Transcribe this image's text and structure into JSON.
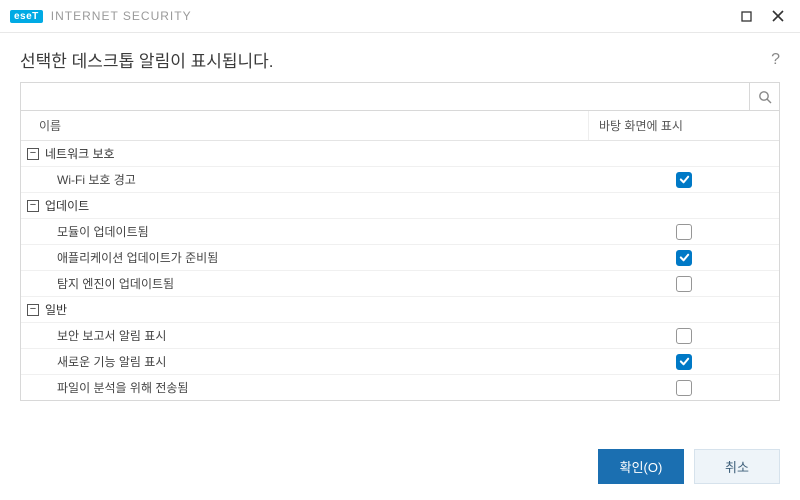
{
  "titlebar": {
    "logo_text": "eseT",
    "product_name": "INTERNET SECURITY"
  },
  "header": {
    "title": "선택한 데스크톱 알림이 표시됩니다.",
    "help": "?"
  },
  "grid": {
    "col_name": "이름",
    "col_show": "바탕 화면에 표시"
  },
  "groups": [
    {
      "label": "네트워크 보호",
      "items": [
        {
          "label": "Wi-Fi 보호 경고",
          "checked": true
        }
      ]
    },
    {
      "label": "업데이트",
      "items": [
        {
          "label": "모듈이 업데이트됨",
          "checked": false
        },
        {
          "label": "애플리케이션 업데이트가 준비됨",
          "checked": true
        },
        {
          "label": "탐지 엔진이 업데이트됨",
          "checked": false
        }
      ]
    },
    {
      "label": "일반",
      "items": [
        {
          "label": "보안 보고서 알림 표시",
          "checked": false
        },
        {
          "label": "새로운 기능 알림 표시",
          "checked": true
        },
        {
          "label": "파일이 분석을 위해 전송됨",
          "checked": false
        }
      ]
    }
  ],
  "footer": {
    "ok": "확인(O)",
    "cancel": "취소"
  }
}
